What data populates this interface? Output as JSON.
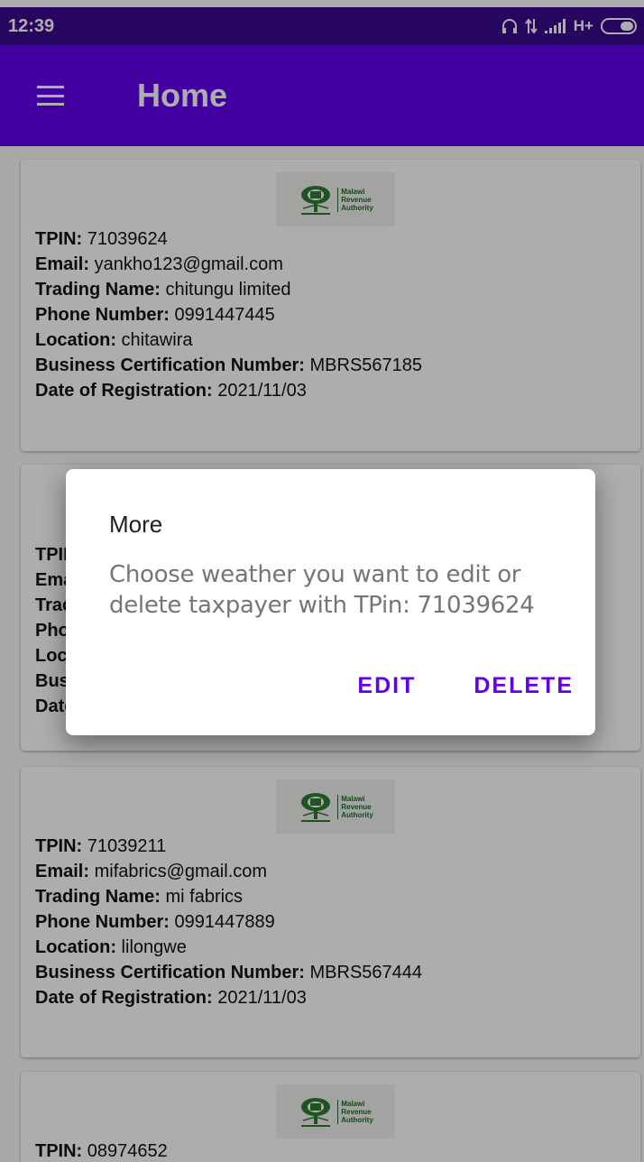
{
  "status_bar": {
    "time": "12:39",
    "network": "H+"
  },
  "app_bar": {
    "title": "Home"
  },
  "logo": {
    "line1": "Malawi",
    "line2": "Revenue",
    "line3": "Authority"
  },
  "labels": {
    "tpin": "TPIN:",
    "email": "Email:",
    "trading_name": "Trading Name:",
    "phone": "Phone Number:",
    "location": "Location:",
    "cert": "Business Certification Number:",
    "date": "Date of Registration:"
  },
  "taxpayers": [
    {
      "tpin": " 71039624",
      "email": " yankho123@gmail.com",
      "trading_name": " chitungu limited",
      "phone": " 0991447445",
      "location": " chitawira",
      "cert": " MBRS567185",
      "date": " 2021/11/03"
    },
    {
      "tpin": "",
      "email": "",
      "trading_name": "",
      "phone": "",
      "location": "",
      "cert": "",
      "date": ""
    },
    {
      "tpin": " 71039211",
      "email": " mifabrics@gmail.com",
      "trading_name": " mi fabrics",
      "phone": " 0991447889",
      "location": " lilongwe",
      "cert": " MBRS567444",
      "date": " 2021/11/03"
    },
    {
      "tpin": " 08974652"
    }
  ],
  "dialog": {
    "title": "More",
    "message": "Choose weather you want to edit or delete taxpayer with TPin: 71039624",
    "edit_label": "EDIT",
    "delete_label": "DELETE"
  },
  "colors": {
    "status_bar": "#3a0a8c",
    "app_bar": "#6200ee",
    "accent": "#6200ee"
  }
}
